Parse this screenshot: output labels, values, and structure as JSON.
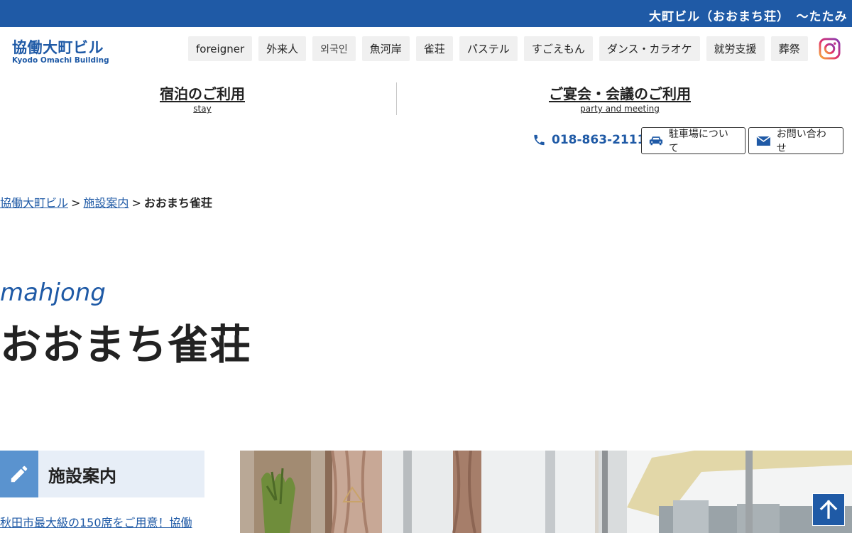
{
  "topbar": {
    "text": "大町ビル（おおまち荘）　〜たたみ"
  },
  "logo": {
    "main": "協働大町ビル",
    "sub": "Kyodo Omachi Building"
  },
  "nav": {
    "items": [
      {
        "label": "foreigner"
      },
      {
        "label": "外来人"
      },
      {
        "label": "외국인"
      },
      {
        "label": "魚河岸"
      },
      {
        "label": "雀荘"
      },
      {
        "label": "パステル"
      },
      {
        "label": "すごえもん"
      },
      {
        "label": "ダンス・カラオケ"
      },
      {
        "label": "就労支援"
      },
      {
        "label": "葬祭"
      }
    ],
    "instagram_icon": "instagram-icon"
  },
  "main_links": {
    "stay": {
      "jp": "宿泊のご利用",
      "en": "stay"
    },
    "party": {
      "jp": "ご宴会・会議のご利用",
      "en": "party and meeting"
    }
  },
  "contact": {
    "phone": "018-863-2111",
    "parking_label": "駐車場について",
    "inquiry_label": "お問い合わせ"
  },
  "breadcrumb": {
    "home": "協働大町ビル",
    "sep1": ">",
    "facilities": "施設案内",
    "sep2": ">",
    "current": "おおまち雀荘"
  },
  "heading": {
    "en": "mahjong",
    "jp": "おおまち雀荘"
  },
  "sidebar": {
    "title": "施設案内",
    "link_text": "秋田市最大級の150席をご用意！協働"
  },
  "colors": {
    "brand_blue": "#1f5aa6",
    "light_blue": "#5a93cf",
    "panel_bg": "#e7eef7"
  }
}
